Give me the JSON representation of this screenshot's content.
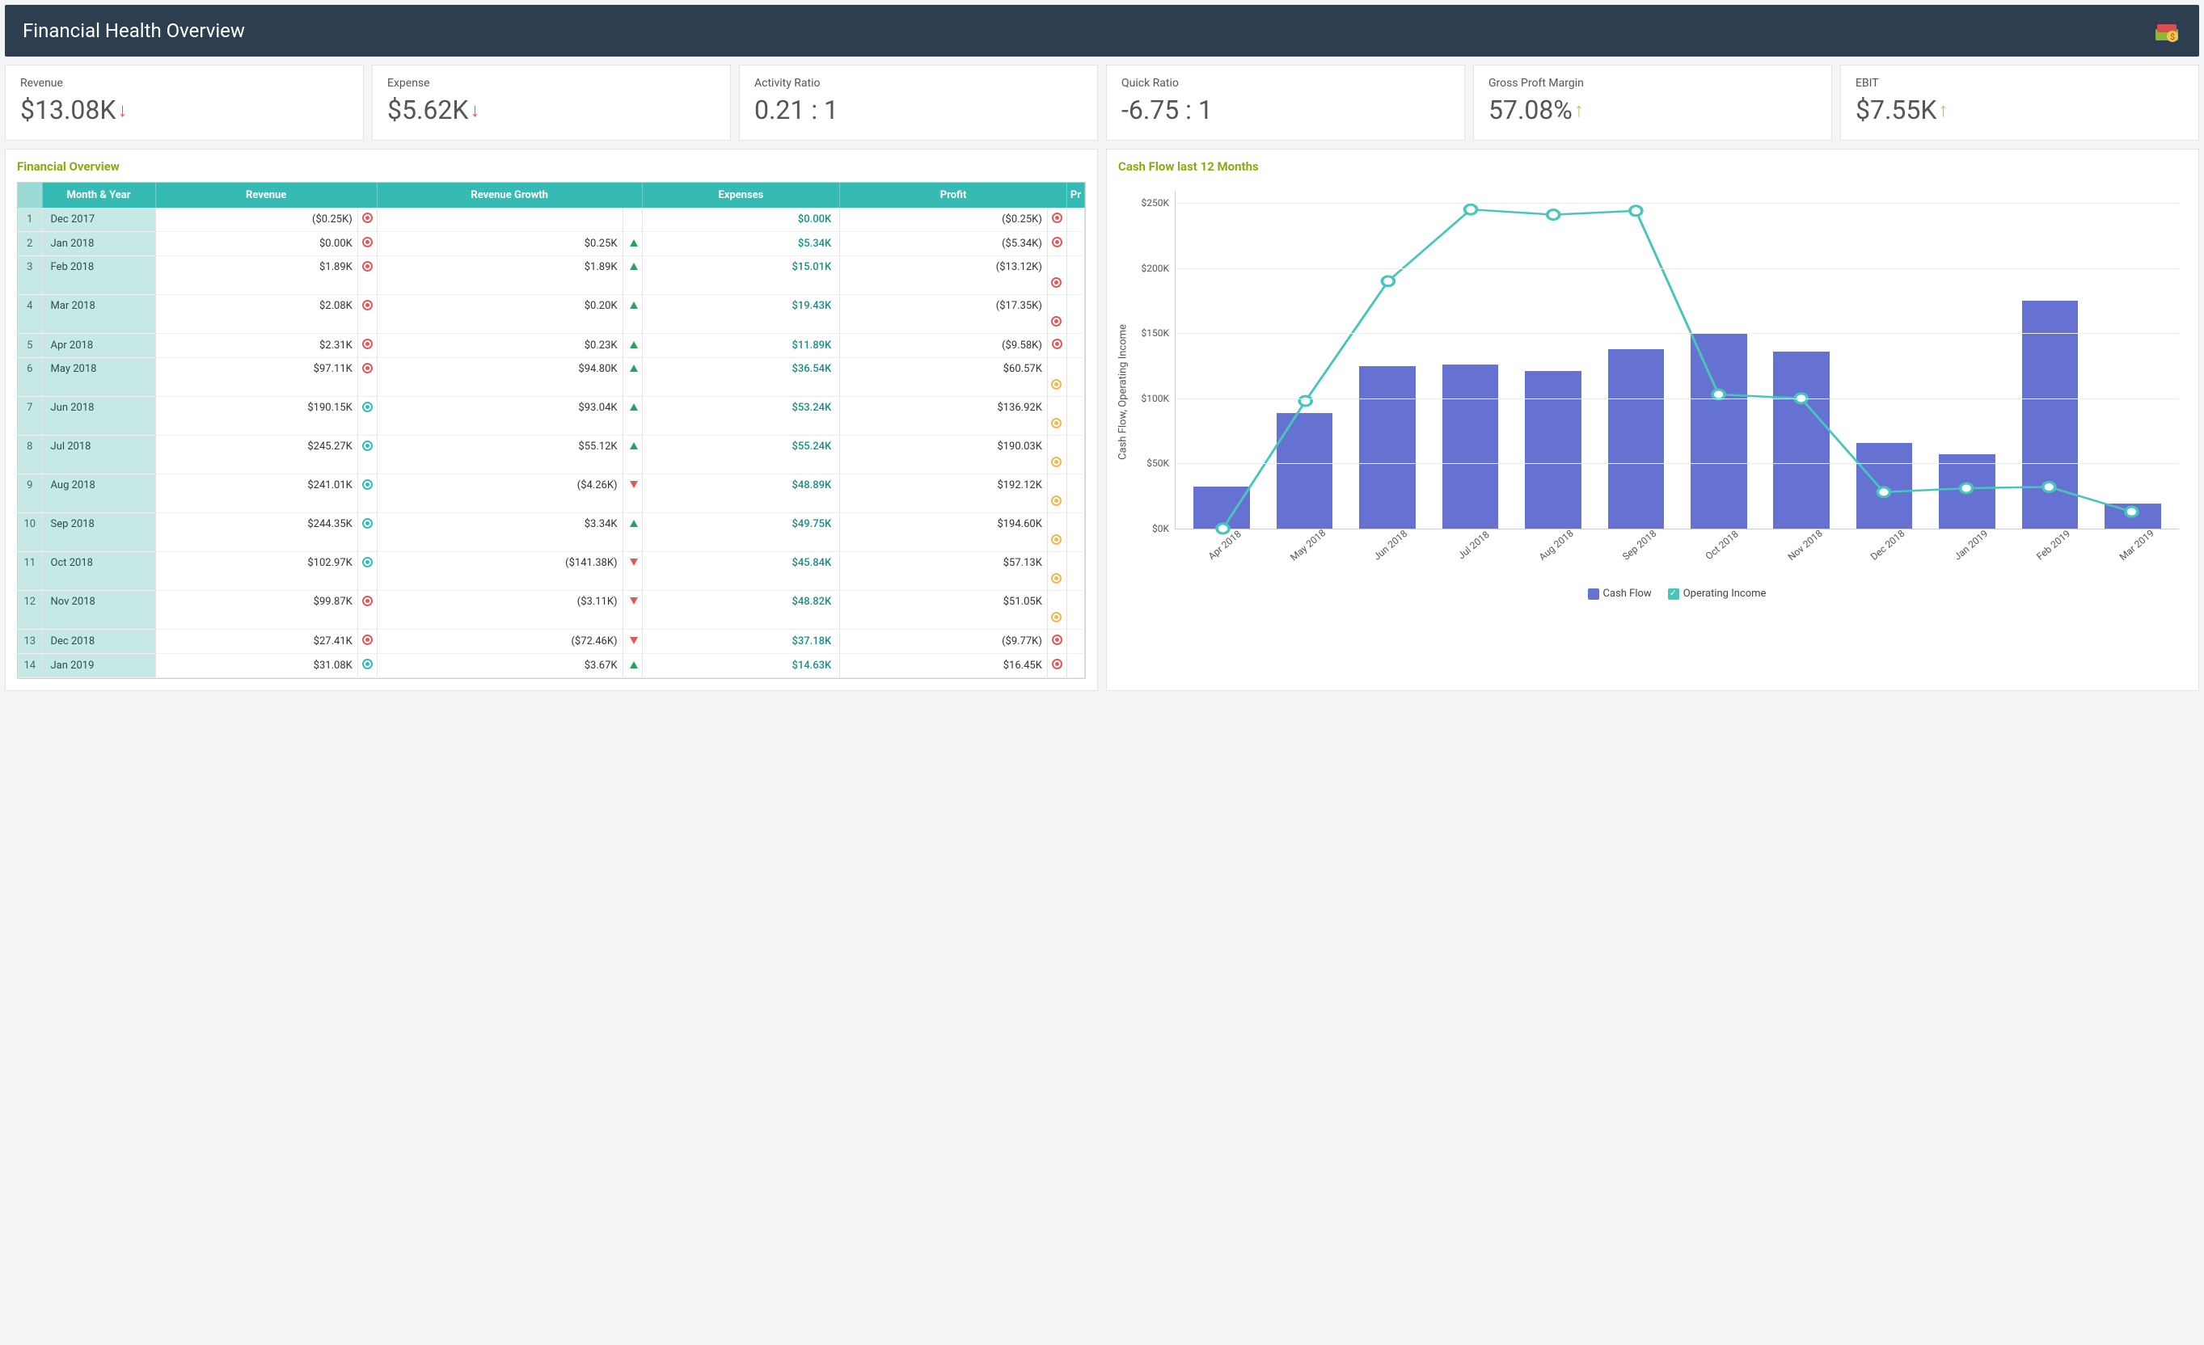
{
  "header": {
    "title": "Financial Health Overview"
  },
  "kpis": [
    {
      "label": "Revenue",
      "value": "$13.08K",
      "trend": "down"
    },
    {
      "label": "Expense",
      "value": "$5.62K",
      "trend": "down"
    },
    {
      "label": "Activity Ratio",
      "value": "0.21 : 1",
      "trend": "none"
    },
    {
      "label": "Quick Ratio",
      "value": "-6.75 : 1",
      "trend": "none"
    },
    {
      "label": "Gross Proft Margin",
      "value": "57.08%",
      "trend": "up"
    },
    {
      "label": "EBIT",
      "value": "$7.55K",
      "trend": "up"
    }
  ],
  "financial_overview": {
    "title": "Financial Overview",
    "columns": [
      "Month & Year",
      "Revenue",
      "Revenue Growth",
      "Expenses",
      "Profit",
      "Pr"
    ],
    "rows": [
      {
        "n": 1,
        "month": "Dec 2017",
        "revenue": "($0.25K)",
        "rev_ind": "red",
        "growth": "",
        "growth_dir": "",
        "expenses": "$0.00K",
        "profit": "($0.25K)",
        "profit_ind": "red",
        "tall": false
      },
      {
        "n": 2,
        "month": "Jan 2018",
        "revenue": "$0.00K",
        "rev_ind": "red",
        "growth": "$0.25K",
        "growth_dir": "up",
        "expenses": "$5.34K",
        "profit": "($5.34K)",
        "profit_ind": "red",
        "tall": false
      },
      {
        "n": 3,
        "month": "Feb 2018",
        "revenue": "$1.89K",
        "rev_ind": "red",
        "growth": "$1.89K",
        "growth_dir": "up",
        "expenses": "$15.01K",
        "profit": "($13.12K)",
        "profit_ind": "red",
        "tall": true
      },
      {
        "n": 4,
        "month": "Mar 2018",
        "revenue": "$2.08K",
        "rev_ind": "red",
        "growth": "$0.20K",
        "growth_dir": "up",
        "expenses": "$19.43K",
        "profit": "($17.35K)",
        "profit_ind": "red",
        "tall": true
      },
      {
        "n": 5,
        "month": "Apr 2018",
        "revenue": "$2.31K",
        "rev_ind": "red",
        "growth": "$0.23K",
        "growth_dir": "up",
        "expenses": "$11.89K",
        "profit": "($9.58K)",
        "profit_ind": "red",
        "tall": false
      },
      {
        "n": 6,
        "month": "May 2018",
        "revenue": "$97.11K",
        "rev_ind": "red",
        "growth": "$94.80K",
        "growth_dir": "up",
        "expenses": "$36.54K",
        "profit": "$60.57K",
        "profit_ind": "amber",
        "tall": true
      },
      {
        "n": 7,
        "month": "Jun 2018",
        "revenue": "$190.15K",
        "rev_ind": "green",
        "growth": "$93.04K",
        "growth_dir": "up",
        "expenses": "$53.24K",
        "profit": "$136.92K",
        "profit_ind": "amber",
        "tall": true
      },
      {
        "n": 8,
        "month": "Jul 2018",
        "revenue": "$245.27K",
        "rev_ind": "green",
        "growth": "$55.12K",
        "growth_dir": "up",
        "expenses": "$55.24K",
        "profit": "$190.03K",
        "profit_ind": "amber",
        "tall": true
      },
      {
        "n": 9,
        "month": "Aug 2018",
        "revenue": "$241.01K",
        "rev_ind": "green",
        "growth": "($4.26K)",
        "growth_dir": "down",
        "expenses": "$48.89K",
        "profit": "$192.12K",
        "profit_ind": "amber",
        "tall": true
      },
      {
        "n": 10,
        "month": "Sep 2018",
        "revenue": "$244.35K",
        "rev_ind": "green",
        "growth": "$3.34K",
        "growth_dir": "up",
        "expenses": "$49.75K",
        "profit": "$194.60K",
        "profit_ind": "amber",
        "tall": true
      },
      {
        "n": 11,
        "month": "Oct 2018",
        "revenue": "$102.97K",
        "rev_ind": "green",
        "growth": "($141.38K)",
        "growth_dir": "down",
        "expenses": "$45.84K",
        "profit": "$57.13K",
        "profit_ind": "amber",
        "tall": true
      },
      {
        "n": 12,
        "month": "Nov 2018",
        "revenue": "$99.87K",
        "rev_ind": "red",
        "growth": "($3.11K)",
        "growth_dir": "down",
        "expenses": "$48.82K",
        "profit": "$51.05K",
        "profit_ind": "amber",
        "tall": true
      },
      {
        "n": 13,
        "month": "Dec 2018",
        "revenue": "$27.41K",
        "rev_ind": "red",
        "growth": "($72.46K)",
        "growth_dir": "down",
        "expenses": "$37.18K",
        "profit": "($9.77K)",
        "profit_ind": "red",
        "tall": false
      },
      {
        "n": 14,
        "month": "Jan 2019",
        "revenue": "$31.08K",
        "rev_ind": "green",
        "growth": "$3.67K",
        "growth_dir": "up",
        "expenses": "$14.63K",
        "profit": "$16.45K",
        "profit_ind": "red",
        "tall": false
      }
    ]
  },
  "cash_flow": {
    "title": "Cash Flow last 12 Months",
    "ylabel": "Cash Flow, Operating Income",
    "legend": {
      "bar": "Cash Flow",
      "line": "Operating Income"
    },
    "yticks": [
      "$0K",
      "$50K",
      "$100K",
      "$150K",
      "$200K",
      "$250K"
    ]
  },
  "chart_data": {
    "type": "bar",
    "title": "Cash Flow last 12 Months",
    "xlabel": "",
    "ylabel": "Cash Flow, Operating Income",
    "ylim": [
      0,
      260
    ],
    "categories": [
      "Apr 2018",
      "May 2018",
      "Jun 2018",
      "Jul 2018",
      "Aug 2018",
      "Sep 2018",
      "Oct 2018",
      "Nov 2018",
      "Dec 2018",
      "Jan 2019",
      "Feb 2019",
      "Mar 2019"
    ],
    "series": [
      {
        "name": "Cash Flow",
        "type": "bar",
        "values": [
          32,
          89,
          125,
          126,
          121,
          138,
          150,
          136,
          66,
          57,
          175,
          19
        ]
      },
      {
        "name": "Operating Income",
        "type": "line",
        "values": [
          0,
          98,
          190,
          245,
          241,
          244,
          103,
          100,
          28,
          31,
          32,
          13
        ]
      }
    ]
  }
}
